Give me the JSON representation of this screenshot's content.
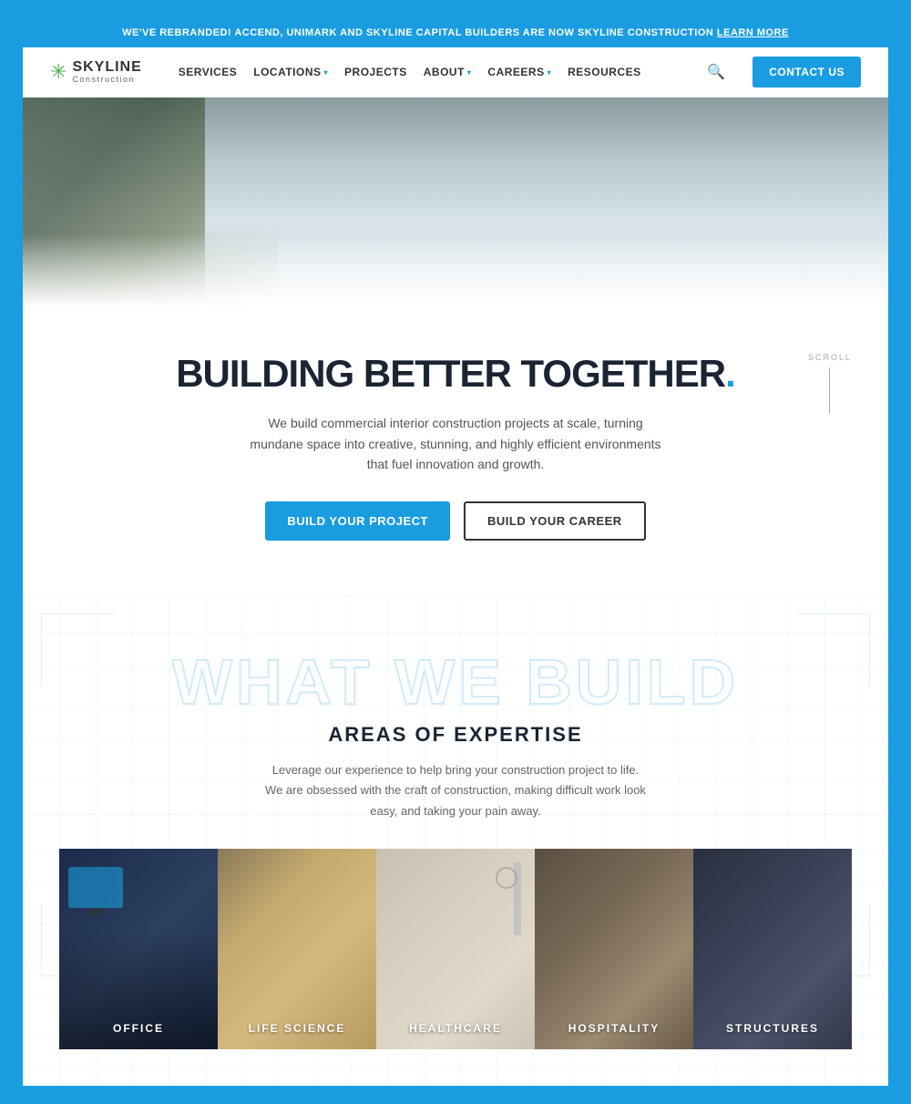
{
  "announcement": {
    "text": "WE'VE REBRANDED! ACCEND, UNIMARK AND SKYLINE CAPITAL BUILDERS ARE NOW SKYLINE CONSTRUCTION",
    "link_text": "LEARN MORE"
  },
  "logo": {
    "company": "SKYLINE",
    "sub": "Construction"
  },
  "nav": {
    "items": [
      {
        "label": "SERVICES",
        "has_dropdown": false
      },
      {
        "label": "LOCATIONS",
        "has_dropdown": true
      },
      {
        "label": "PROJECTS",
        "has_dropdown": false
      },
      {
        "label": "ABOUT",
        "has_dropdown": true
      },
      {
        "label": "CAREERS",
        "has_dropdown": true
      },
      {
        "label": "RESOURCES",
        "has_dropdown": false
      }
    ],
    "contact_button": "CONTACT US"
  },
  "hero": {
    "title": "BUILDING BETTER TOGETHER",
    "title_dot": ".",
    "subtitle": "We build commercial interior construction projects at scale, turning mundane space into creative, stunning, and highly efficient environments that fuel innovation and growth.",
    "btn_primary": "BUILD YOUR PROJECT",
    "btn_outline": "BUILD YOUR CAREER",
    "scroll_label": "SCROLL"
  },
  "what_we_build": {
    "bg_title": "WHAT WE BUILD",
    "section_title": "AREAS OF EXPERTISE",
    "description": "Leverage our experience to help bring your construction project to life.\nWe are obsessed with the craft of construction, making difficult work look easy, and taking your pain away.",
    "cards": [
      {
        "label": "OFFICE",
        "class": "card-office"
      },
      {
        "label": "LIFE SCIENCE",
        "class": "card-lifescience"
      },
      {
        "label": "HEALTHCARE",
        "class": "card-healthcare"
      },
      {
        "label": "HOSPITALITY",
        "class": "card-hospitality"
      },
      {
        "label": "STRUCTURES",
        "class": "card-structures"
      }
    ]
  }
}
